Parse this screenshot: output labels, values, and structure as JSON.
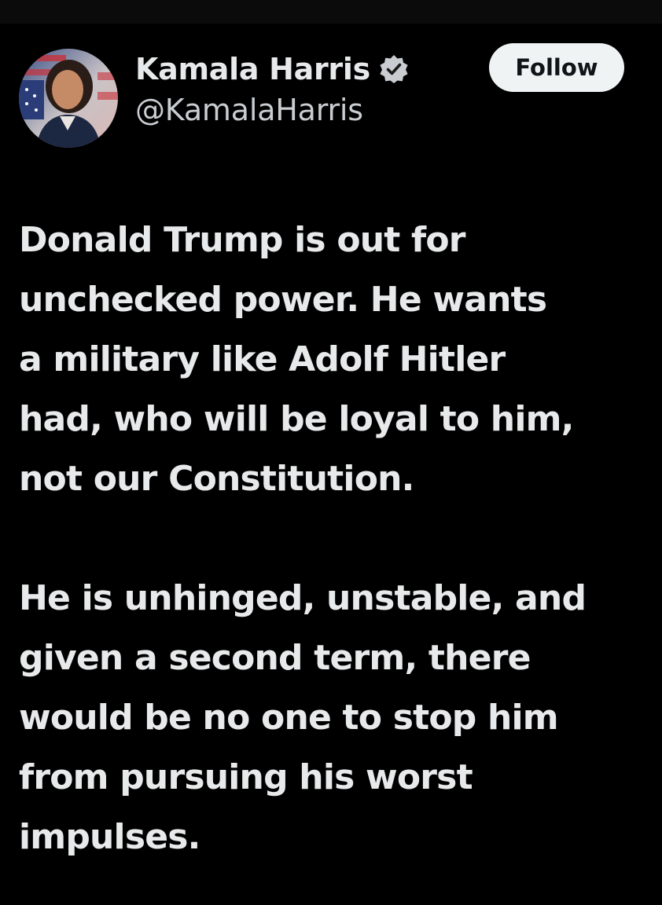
{
  "author": {
    "display_name": "Kamala Harris",
    "handle": "@KamalaHarris",
    "verified": true,
    "verified_icon": "verified-badge-icon",
    "avatar_icon": "profile-photo"
  },
  "actions": {
    "follow_label": "Follow"
  },
  "tweet": {
    "paragraphs": [
      "Donald Trump is out for\nunchecked power. He wants\na military like Adolf Hitler\nhad, who will be loyal to him,\nnot our Constitution.",
      "He is unhinged, unstable, and\ngiven a second term, there\nwould be no one to stop him\nfrom pursuing his worst\nimpulses."
    ]
  },
  "colors": {
    "background": "#000000",
    "text": "#e7e9ea",
    "button_bg": "#eff3f4",
    "badge": "#c9cdd1"
  }
}
